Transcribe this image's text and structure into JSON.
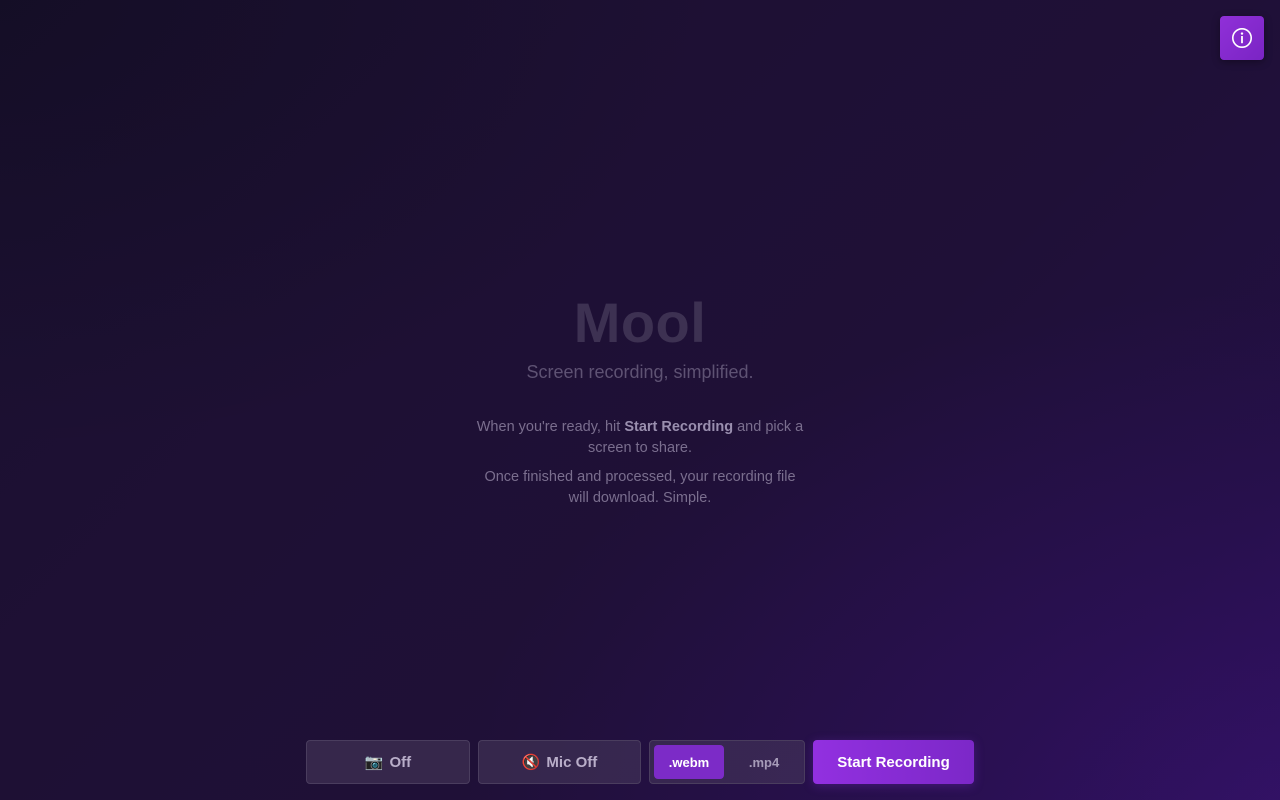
{
  "app": {
    "title": "Mool",
    "subtitle": "Screen recording, simplified."
  },
  "info_button": {
    "icon": "info-icon"
  },
  "description": {
    "line1_prefix": "When you're ready, hit ",
    "line1_bold": "Start Recording",
    "line1_suffix": " and pick a screen to share.",
    "line2": "Once finished and processed, your recording file will download. Simple."
  },
  "controls": {
    "camera": {
      "icon": "camera-icon",
      "icon_glyph": "📷",
      "label": "Off"
    },
    "mic": {
      "icon": "muted-speaker-icon",
      "icon_glyph": "🔇",
      "label": "Mic Off"
    },
    "formats": [
      {
        "label": ".webm",
        "selected": true
      },
      {
        "label": ".mp4",
        "selected": false
      }
    ],
    "start_label": "Start Recording"
  },
  "colors": {
    "accent": "#8a2fd6",
    "background": "#1e1034"
  }
}
